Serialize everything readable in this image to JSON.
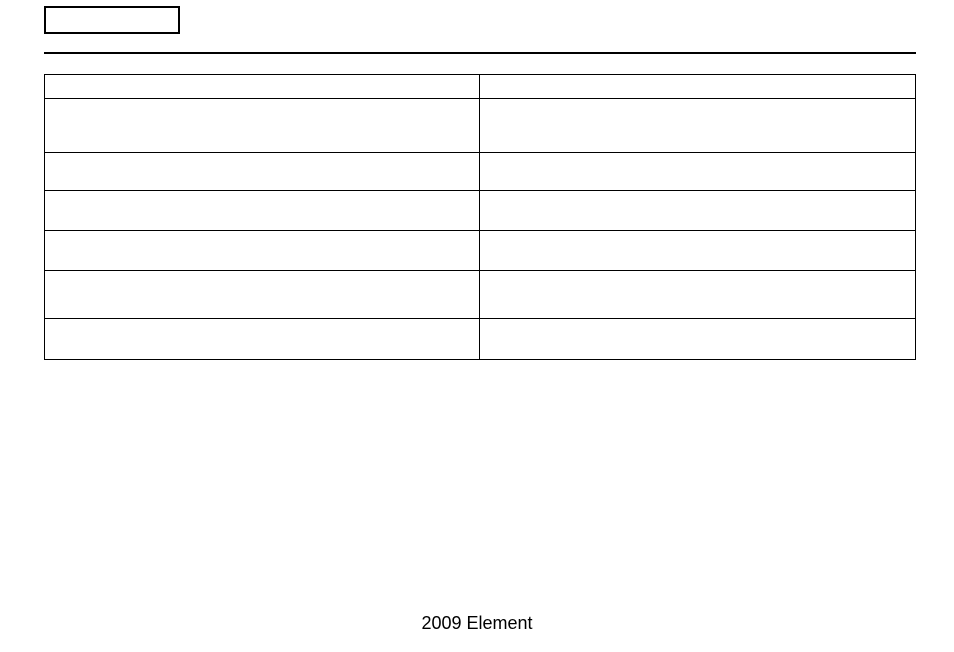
{
  "header": {
    "box_label": ""
  },
  "table": {
    "rows": [
      {
        "left": "",
        "right": ""
      },
      {
        "left": "",
        "right": ""
      },
      {
        "left": "",
        "right": ""
      },
      {
        "left": "",
        "right": ""
      },
      {
        "left": "",
        "right": ""
      },
      {
        "left": "",
        "right": ""
      },
      {
        "left": "",
        "right": ""
      }
    ]
  },
  "footer": {
    "text": "2009  Element"
  }
}
